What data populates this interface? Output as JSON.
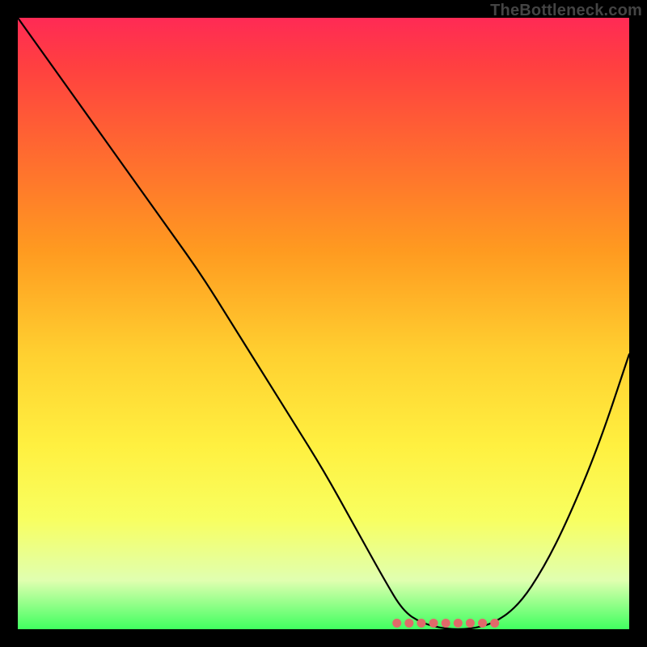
{
  "watermark": "TheBottleneck.com",
  "chart_data": {
    "type": "line",
    "title": "",
    "xlabel": "",
    "ylabel": "",
    "xlim": [
      0,
      100
    ],
    "ylim": [
      0,
      100
    ],
    "x": [
      0,
      5,
      10,
      15,
      20,
      25,
      30,
      35,
      40,
      45,
      50,
      55,
      60,
      63,
      66,
      70,
      74,
      78,
      82,
      86,
      90,
      95,
      100
    ],
    "values": [
      100,
      93,
      86,
      79,
      72,
      65,
      58,
      50,
      42,
      34,
      26,
      17,
      8,
      3,
      1,
      0,
      0,
      1,
      4,
      10,
      18,
      30,
      45
    ],
    "flat_segment_markers_x": [
      62,
      64,
      66,
      68,
      70,
      72,
      74,
      76,
      78
    ],
    "marker_y": 1
  }
}
